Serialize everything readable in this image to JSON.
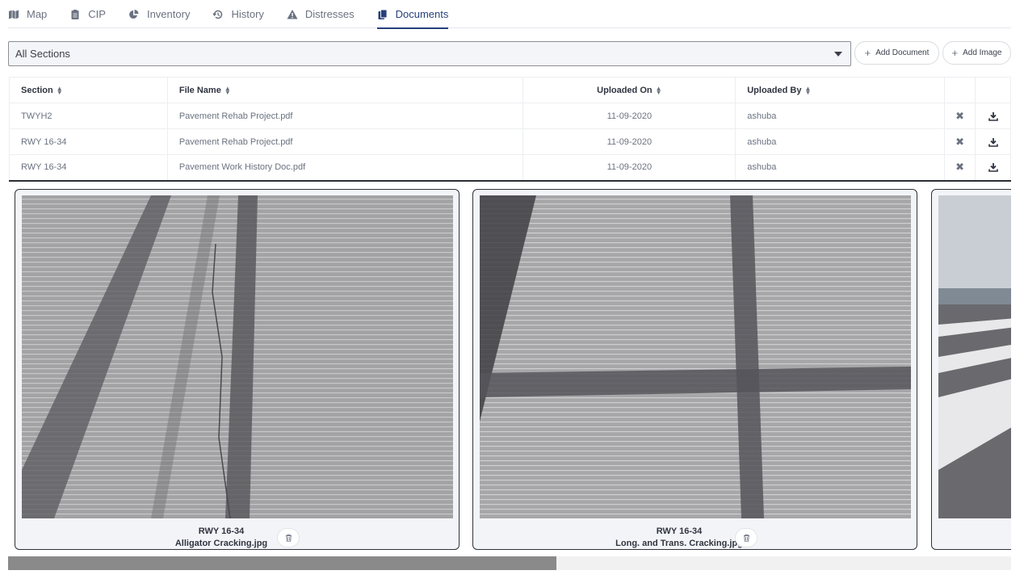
{
  "tabs": [
    {
      "label": "Map",
      "icon": "map-icon"
    },
    {
      "label": "CIP",
      "icon": "clipboard-icon"
    },
    {
      "label": "Inventory",
      "icon": "pie-chart-icon"
    },
    {
      "label": "History",
      "icon": "history-icon"
    },
    {
      "label": "Distresses",
      "icon": "warning-icon"
    },
    {
      "label": "Documents",
      "icon": "documents-icon",
      "active": true
    }
  ],
  "filter": {
    "selected": "All Sections"
  },
  "actions": {
    "add_document": "Add Document",
    "add_image": "Add Image"
  },
  "table": {
    "headers": {
      "section": "Section",
      "file_name": "File Name",
      "uploaded_on": "Uploaded On",
      "uploaded_by": "Uploaded By"
    },
    "rows": [
      {
        "section": "TWYH2",
        "file_name": "Pavement Rehab Project.pdf",
        "uploaded_on": "11-09-2020",
        "uploaded_by": "ashuba"
      },
      {
        "section": "RWY 16-34",
        "file_name": "Pavement Rehab Project.pdf",
        "uploaded_on": "11-09-2020",
        "uploaded_by": "ashuba"
      },
      {
        "section": "RWY 16-34",
        "file_name": "Pavement Work History Doc.pdf",
        "uploaded_on": "11-09-2020",
        "uploaded_by": "ashuba"
      }
    ]
  },
  "images": [
    {
      "section": "RWY 16-34",
      "file_name": "Alligator Cracking.jpg"
    },
    {
      "section": "RWY 16-34",
      "file_name": "Long. and Trans. Cracking.jpg"
    },
    {
      "section": "",
      "file_name": ""
    }
  ],
  "scroll": {
    "fraction": 0.547
  },
  "colors": {
    "accent": "#27407a",
    "delete": "#e02424",
    "scroll_thumb": "#8a8a8a"
  }
}
